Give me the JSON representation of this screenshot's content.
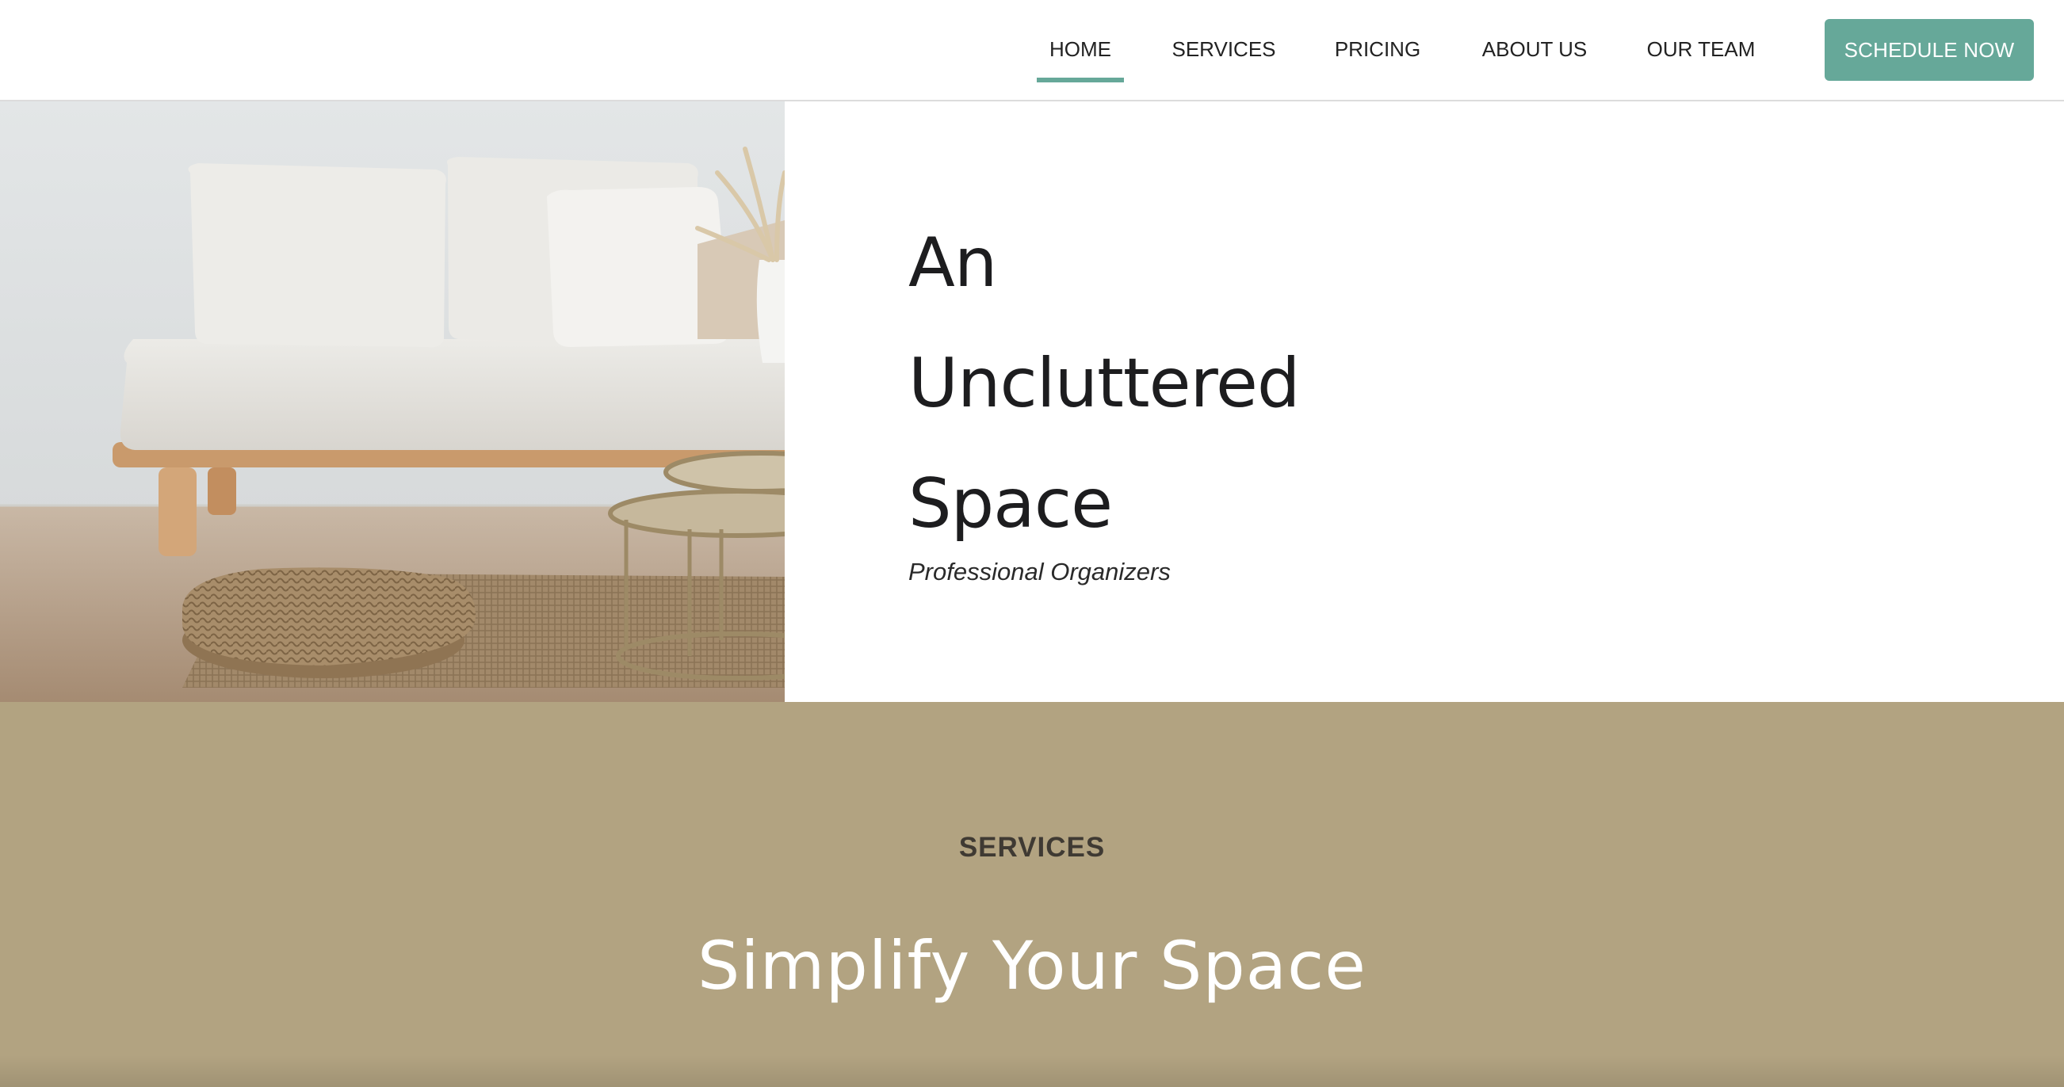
{
  "nav": {
    "items": [
      {
        "label": "HOME",
        "active": true
      },
      {
        "label": "SERVICES",
        "active": false
      },
      {
        "label": "PRICING",
        "active": false
      },
      {
        "label": "ABOUT US",
        "active": false
      },
      {
        "label": "OUR TEAM",
        "active": false
      }
    ],
    "cta_label": "SCHEDULE NOW"
  },
  "hero": {
    "title_lines": [
      "An",
      "Uncluttered",
      "Space"
    ],
    "subtitle": "Professional Organizers",
    "image_icon": "living-room-photo"
  },
  "services": {
    "eyebrow": "SERVICES",
    "heading": "Simplify Your Space"
  },
  "colors": {
    "accent": "#66a899",
    "band": "#b2a381",
    "text_dark": "#1d1d1f"
  }
}
